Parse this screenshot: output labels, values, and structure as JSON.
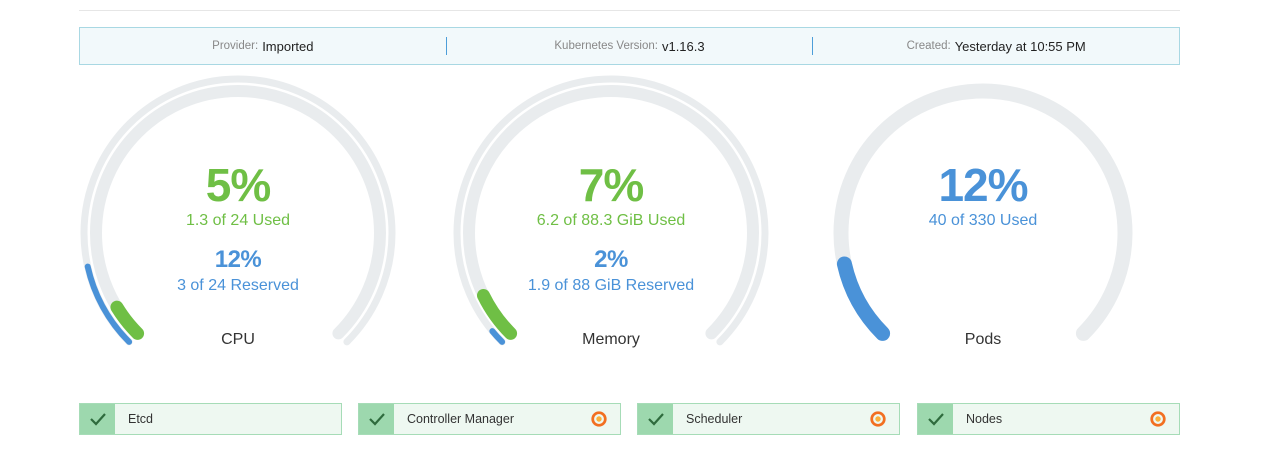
{
  "info": {
    "provider_label": "Provider:",
    "provider_value": "Imported",
    "k8s_label": "Kubernetes Version:",
    "k8s_value": "v1.16.3",
    "created_label": "Created:",
    "created_value": "Yesterday at 10:55 PM"
  },
  "gauges": {
    "cpu": {
      "used_pct": "5%",
      "used_text": "1.3 of 24 Used",
      "reserved_pct": "12%",
      "reserved_text": "3 of 24 Reserved",
      "title": "CPU",
      "used_frac": 0.05,
      "reserved_frac": 0.12
    },
    "memory": {
      "used_pct": "7%",
      "used_text": "6.2 of 88.3 GiB Used",
      "reserved_pct": "2%",
      "reserved_text": "1.9 of 88 GiB Reserved",
      "title": "Memory",
      "used_frac": 0.07,
      "reserved_frac": 0.02
    },
    "pods": {
      "used_pct": "12%",
      "used_text": "40 of 330 Used",
      "title": "Pods",
      "used_frac": 0.12
    }
  },
  "components": [
    {
      "name": "Etcd",
      "status": "healthy",
      "grafana": false
    },
    {
      "name": "Controller Manager",
      "status": "healthy",
      "grafana": true
    },
    {
      "name": "Scheduler",
      "status": "healthy",
      "grafana": true
    },
    {
      "name": "Nodes",
      "status": "healthy",
      "grafana": true
    }
  ],
  "colors": {
    "green": "#6fbf45",
    "blue": "#4a92d8",
    "track": "#e9ecee"
  }
}
